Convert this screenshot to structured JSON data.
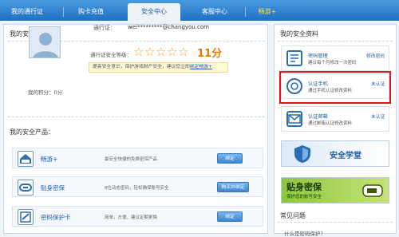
{
  "tabs": [
    {
      "label": "我的通行证"
    },
    {
      "label": "购卡充值"
    },
    {
      "label": "安全中心"
    },
    {
      "label": "客服中心"
    },
    {
      "label": "畅游+"
    }
  ],
  "main": {
    "security_title": "我的安全中心：",
    "passport_label": "通行证：",
    "passport_value": "wei*********@changyou.com",
    "level_label": "通行证安全等级：",
    "stars": 5,
    "score": "11分",
    "points_label": "我的积分：",
    "points_value": "0分",
    "tip_text": "提高安全意识，保护游戏财产安全，建议您立即",
    "tip_link": "绑定畅游+",
    "products_title": "我的安全产品：",
    "products": [
      {
        "name": "畅游+",
        "desc": "最安全快捷的免费密保产品",
        "button": "绑定"
      },
      {
        "name": "贴身密保",
        "desc": "8位动态密码，轻松确保账号安全",
        "button": "购买并绑定"
      },
      {
        "name": "密码保护卡",
        "desc": "简单，方便，建议定期更换",
        "button": "绑定"
      }
    ]
  },
  "side": {
    "title": "我的安全资料",
    "items": [
      {
        "title": "密码管理",
        "desc": "建议每个月修改一次密码",
        "link": "修改密码"
      },
      {
        "title": "认证手机",
        "desc": "通过手机认证修改资料",
        "link": "未认证"
      },
      {
        "title": "认证邮箱",
        "desc": "通过邮箱认证修改资料",
        "link": "未认证"
      }
    ],
    "banner1": "安全学堂",
    "banner2_title": "贴身密保",
    "banner2_sub": "保护您的帐号安全",
    "faq_title": "常见问题",
    "faq_first": "什么是密码保护？"
  }
}
